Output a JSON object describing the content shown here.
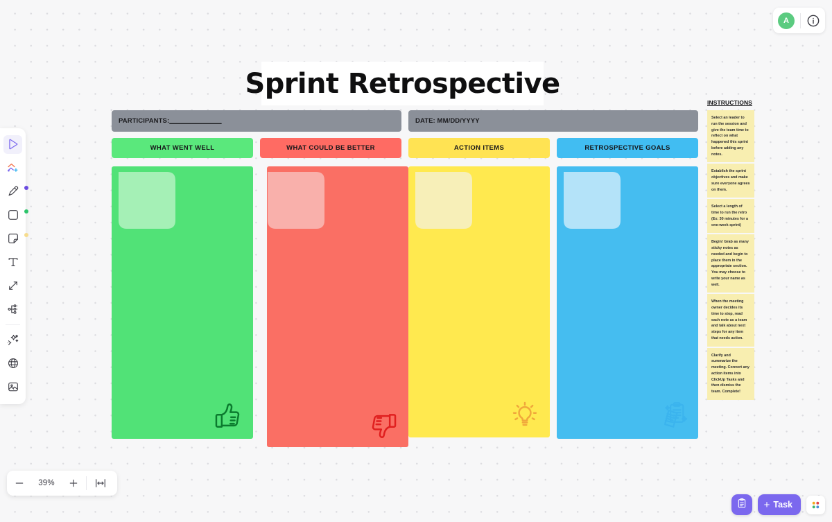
{
  "app": {
    "zoom_level": "39%",
    "accent_color": "#7b68ee"
  },
  "topbar": {
    "avatar_initial": "A",
    "avatar_color": "#5bcb80",
    "avatar_name": "avatar",
    "help_icon": "info-circle-icon"
  },
  "toolbar": {
    "items": [
      {
        "name": "select-tool",
        "icon": "cursor-icon",
        "active": true,
        "dot": ""
      },
      {
        "name": "connector-tool",
        "icon": "connector-icon",
        "active": false,
        "dot": ""
      },
      {
        "name": "pen-tool",
        "icon": "pen-icon",
        "active": false,
        "dot": "#6b4ce0"
      },
      {
        "name": "shape-tool",
        "icon": "square-icon",
        "active": false,
        "dot": "#2dc46a"
      },
      {
        "name": "sticky-note-tool",
        "icon": "sticky-note-icon",
        "active": false,
        "dot": "#f6dc8e"
      },
      {
        "name": "text-tool",
        "icon": "text-icon",
        "active": false,
        "dot": ""
      },
      {
        "name": "arrow-tool",
        "icon": "double-arrow-icon",
        "active": false,
        "dot": ""
      },
      {
        "name": "mindmap-tool",
        "icon": "mindmap-icon",
        "active": false,
        "dot": ""
      },
      {
        "name": "ai-tool",
        "icon": "magic-wand-icon",
        "active": false,
        "dot": ""
      },
      {
        "name": "embed-tool",
        "icon": "globe-icon",
        "active": false,
        "dot": ""
      },
      {
        "name": "image-tool",
        "icon": "image-icon",
        "active": false,
        "dot": ""
      }
    ]
  },
  "zoombar": {
    "zoom_out_label": "−",
    "zoom_value": "39%",
    "zoom_in_label": "+",
    "fit_icon": "fit-to-screen-icon"
  },
  "actionbar": {
    "clipboard_icon": "clipboard-icon",
    "task_label": "Task",
    "task_plus": "+",
    "apps_icon": "apps-grid-icon"
  },
  "board": {
    "title": "Sprint Retrospective",
    "participants_label": "PARTICIPANTS:",
    "participants_blank": "______________",
    "date_label": "DATE: MM/DD/YYYY",
    "columns": [
      {
        "name": "what-went-well",
        "header": "WHAT WENT WELL",
        "header_color": "#5ae87c",
        "body_color": "#51e277",
        "sticky_color": "#a5f0b6",
        "icon": "thumbs-up-icon",
        "icon_color": "#0b7a2e"
      },
      {
        "name": "what-could-be-better",
        "header": "WHAT COULD BE BETTER",
        "header_color": "#ff6b63",
        "body_color": "#fa6f64",
        "sticky_color": "#f9b0ab",
        "icon": "thumbs-down-icon",
        "icon_color": "#e01f1f"
      },
      {
        "name": "action-items",
        "header": "ACTION ITEMS",
        "header_color": "#ffe353",
        "body_color": "#ffe94f",
        "sticky_color": "#f7efb8",
        "icon": "lightbulb-icon",
        "icon_color": "#f0a73b"
      },
      {
        "name": "retrospective-goals",
        "header": "RETROSPECTIVE GOALS",
        "header_color": "#41bdf2",
        "body_color": "#45bdf0",
        "sticky_color": "#b4e3f9",
        "icon": "notes-clipboard-icon",
        "icon_color": "#3bb4ee"
      }
    ]
  },
  "instructions": {
    "title": "INSTRUCTIONS",
    "notes": [
      "Select an leader to run the session and give the team time to reflect on what happened this sprint before adding any notes.",
      "Establish the sprint objectives and make sure everyone agrees on them.",
      "Select a length of time to run the retro (Ex: 30 minutes for a one-week sprint)",
      "Begin! Grab as many sticky notes as needed and begin to place them in the appropriate section. You may choose to write your name as well.",
      "When the meeting owner decides its time to stop, read each note as a team and talk about next steps for any item that needs action.",
      "Clarify and summarize the meeting. Convert any action items into ClickUp Tasks and then dismiss the team. Complete!"
    ]
  }
}
